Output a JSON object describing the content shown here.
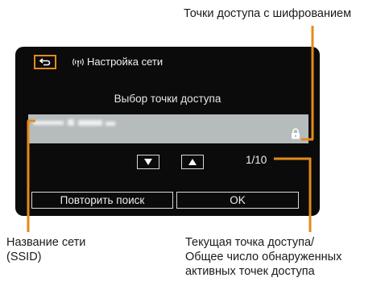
{
  "annotations": {
    "encrypted_ap": "Точки доступа с шифрованием",
    "ssid_line1": "Название сети",
    "ssid_line2": "(SSID)",
    "count_line1": "Текущая точка доступа/",
    "count_line2": "Общее число обнаруженных",
    "count_line3": "активных точек доступа"
  },
  "screen": {
    "back_icon": "return-arrow-icon",
    "wifi_icon": "wireless-signal-icon",
    "header_title": "Настройка сети",
    "subtitle": "Выбор точки доступа",
    "ssid_value": "[blurred network name]",
    "lock_icon": "lock-icon",
    "down_icon": "triangle-down-icon",
    "up_icon": "triangle-up-icon",
    "counter": "1/10",
    "retry_label": "Повторить поиск",
    "ok_label": "OK"
  },
  "colors": {
    "accent_orange": "#e58a18",
    "screen_background": "#0b0b0b",
    "ssid_row_background": "#b6bcbc"
  }
}
